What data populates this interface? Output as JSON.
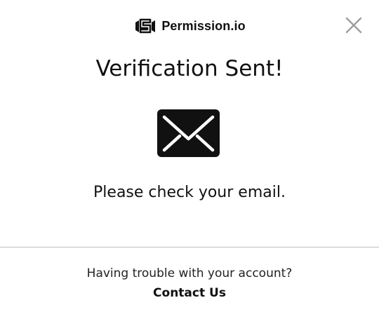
{
  "brand": {
    "name": "Permission.io",
    "logo_icon": "permission-handshake-logo"
  },
  "dialog": {
    "close_icon": "close-icon",
    "title": "Verification Sent!",
    "illustration_icon": "envelope-icon",
    "message": "Please check your email."
  },
  "footer": {
    "trouble_text": "Having trouble with your account?",
    "contact_label": "Contact Us"
  },
  "colors": {
    "text": "#111111",
    "close": "#9e9e9e",
    "divider": "#bdbdbd",
    "background": "#ffffff"
  }
}
